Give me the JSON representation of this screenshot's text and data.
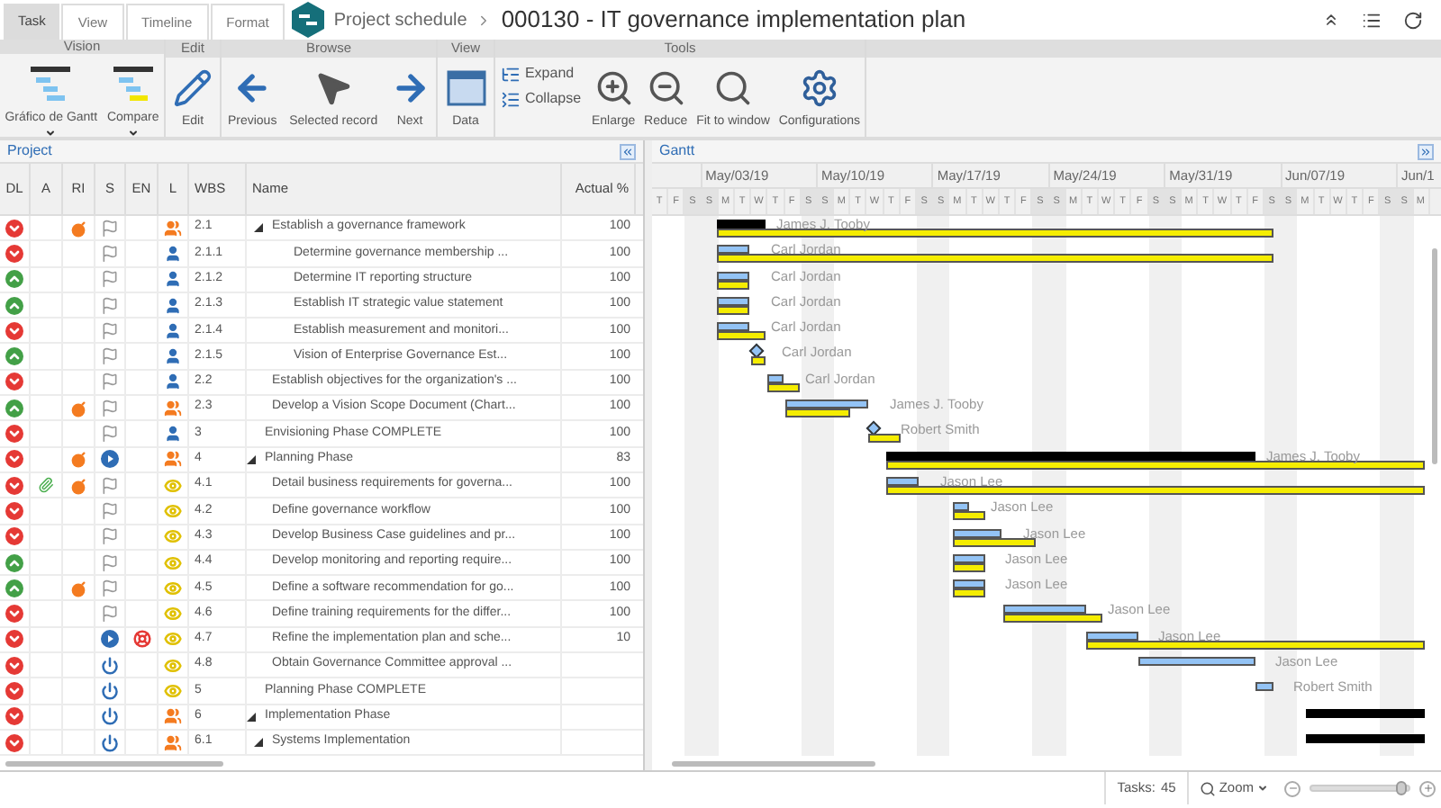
{
  "tabs": [
    {
      "label": "Task",
      "selected": true
    },
    {
      "label": "View",
      "selected": false
    },
    {
      "label": "Timeline",
      "selected": false
    },
    {
      "label": "Format",
      "selected": false
    }
  ],
  "breadcrumb": {
    "parent": "Project schedule",
    "title": "000130 - IT governance implementation plan"
  },
  "toolbar": {
    "groups": [
      {
        "label": "Vision",
        "buttons": [
          {
            "label": "Gráfico de Gantt",
            "kind": "gantt",
            "dropdown": true
          },
          {
            "label": "Compare",
            "kind": "compare",
            "dropdown": true
          }
        ]
      },
      {
        "label": "Edit",
        "buttons": [
          {
            "label": "Edit",
            "kind": "edit"
          }
        ]
      },
      {
        "label": "Browse",
        "buttons": [
          {
            "label": "Previous",
            "kind": "previous"
          },
          {
            "label": "Selected record",
            "kind": "pointer"
          },
          {
            "label": "Next",
            "kind": "next"
          }
        ]
      },
      {
        "label": "View",
        "buttons": [
          {
            "label": "Data",
            "kind": "data"
          }
        ]
      },
      {
        "label": "Tools",
        "buttons": [
          {
            "kind": "stack",
            "items": [
              {
                "label": "Expand",
                "kind": "expand"
              },
              {
                "label": "Collapse",
                "kind": "collapse"
              }
            ]
          },
          {
            "label": "Enlarge",
            "kind": "enlarge"
          },
          {
            "label": "Reduce",
            "kind": "reduce"
          },
          {
            "label": "Fit to window",
            "kind": "fit"
          },
          {
            "label": "Configurations",
            "kind": "config"
          }
        ]
      }
    ]
  },
  "project": {
    "title": "Project",
    "columns": [
      "DL",
      "A",
      "RI",
      "S",
      "EN",
      "L",
      "WBS",
      "Name",
      "Actual %"
    ],
    "tasks": [
      {
        "children": [
          {
            "late": true,
            "attachment": false,
            "risk": true,
            "status": {
              "kind": "done"
            },
            "issue": false,
            "role": {
              "kind": "team"
            },
            "wbs": "2.1",
            "name": "Establish a governance framework",
            "actual": "100",
            "resource": "James J. Tooby",
            "expanded": true,
            "children": [
              {
                "late": true,
                "attachment": false,
                "risk": false,
                "status": {
                  "kind": "done"
                },
                "issue": false,
                "role": {
                  "kind": "person"
                },
                "wbs": "2.1.1",
                "name": "Determine governance membership ...",
                "actual": "100",
                "resource": "Carl Jordan"
              },
              {
                "late": false,
                "attachment": false,
                "risk": false,
                "status": {
                  "kind": "done"
                },
                "issue": false,
                "role": {
                  "kind": "person"
                },
                "wbs": "2.1.2",
                "name": "Determine IT reporting structure",
                "actual": "100",
                "resource": "Carl Jordan"
              },
              {
                "late": false,
                "attachment": false,
                "risk": false,
                "status": {
                  "kind": "done"
                },
                "issue": false,
                "role": {
                  "kind": "person"
                },
                "wbs": "2.1.3",
                "name": "Establish IT strategic value statement",
                "actual": "100",
                "resource": "Carl Jordan"
              },
              {
                "late": true,
                "attachment": false,
                "risk": false,
                "status": {
                  "kind": "done"
                },
                "issue": false,
                "role": {
                  "kind": "person"
                },
                "wbs": "2.1.4",
                "name": "Establish measurement and monitori...",
                "actual": "100",
                "resource": "Carl Jordan"
              },
              {
                "late": false,
                "attachment": false,
                "risk": false,
                "status": {
                  "kind": "done"
                },
                "issue": false,
                "role": {
                  "kind": "person"
                },
                "wbs": "2.1.5",
                "name": "Vision of Enterprise Governance Est...",
                "actual": "100",
                "resource": "Carl Jordan"
              }
            ]
          },
          {
            "late": true,
            "attachment": false,
            "risk": false,
            "status": {
              "kind": "done"
            },
            "issue": false,
            "role": {
              "kind": "person"
            },
            "wbs": "2.2",
            "name": "Establish objectives for the organization's ...",
            "actual": "100",
            "resource": "Carl Jordan"
          },
          {
            "late": false,
            "attachment": false,
            "risk": true,
            "status": {
              "kind": "done"
            },
            "issue": false,
            "role": {
              "kind": "team"
            },
            "wbs": "2.3",
            "name": "Develop a Vision Scope Document (Chart...",
            "actual": "100",
            "resource": "James J. Tooby"
          }
        ]
      },
      {
        "late": true,
        "attachment": false,
        "risk": false,
        "status": {
          "kind": "done"
        },
        "issue": false,
        "role": {
          "kind": "person"
        },
        "wbs": "3",
        "name": "Envisioning Phase COMPLETE",
        "actual": "100",
        "resource": "Robert Smith"
      },
      {
        "late": true,
        "attachment": false,
        "risk": true,
        "status": {
          "kind": "running"
        },
        "issue": false,
        "role": {
          "kind": "team"
        },
        "wbs": "4",
        "name": "Planning Phase",
        "actual": "83",
        "resource": "James J. Tooby",
        "expanded": true,
        "children": [
          {
            "late": true,
            "attachment": true,
            "risk": true,
            "status": {
              "kind": "done"
            },
            "issue": false,
            "role": {
              "kind": "watcher"
            },
            "wbs": "4.1",
            "name": "Detail business requirements for governa...",
            "actual": "100",
            "resource": "Jason Lee"
          },
          {
            "late": true,
            "attachment": false,
            "risk": false,
            "status": {
              "kind": "done"
            },
            "issue": false,
            "role": {
              "kind": "watcher"
            },
            "wbs": "4.2",
            "name": "Define governance workflow",
            "actual": "100",
            "resource": "Jason Lee"
          },
          {
            "late": true,
            "attachment": false,
            "risk": false,
            "status": {
              "kind": "done"
            },
            "issue": false,
            "role": {
              "kind": "watcher"
            },
            "wbs": "4.3",
            "name": "Develop Business Case guidelines and pr...",
            "actual": "100",
            "resource": "Jason Lee"
          },
          {
            "late": false,
            "attachment": false,
            "risk": false,
            "status": {
              "kind": "done"
            },
            "issue": false,
            "role": {
              "kind": "watcher"
            },
            "wbs": "4.4",
            "name": "Develop monitoring and reporting require...",
            "actual": "100",
            "resource": "Jason Lee"
          },
          {
            "late": false,
            "attachment": false,
            "risk": true,
            "status": {
              "kind": "done"
            },
            "issue": false,
            "role": {
              "kind": "watcher"
            },
            "wbs": "4.5",
            "name": "Define a software recommendation for go...",
            "actual": "100",
            "resource": "Jason Lee"
          },
          {
            "late": true,
            "attachment": false,
            "risk": false,
            "status": {
              "kind": "done"
            },
            "issue": false,
            "role": {
              "kind": "watcher"
            },
            "wbs": "4.6",
            "name": "Define training requirements for the differ...",
            "actual": "100",
            "resource": "Jason Lee"
          },
          {
            "late": true,
            "attachment": false,
            "risk": false,
            "status": {
              "kind": "running"
            },
            "issue": true,
            "role": {
              "kind": "watcher"
            },
            "wbs": "4.7",
            "name": "Refine the implementation plan and sche...",
            "actual": "10",
            "resource": "Jason Lee"
          },
          {
            "late": true,
            "attachment": false,
            "risk": false,
            "status": {
              "kind": "pending"
            },
            "issue": false,
            "role": {
              "kind": "watcher"
            },
            "wbs": "4.8",
            "name": "Obtain Governance Committee approval ...",
            "resource": "Jason Lee"
          }
        ]
      },
      {
        "late": true,
        "attachment": false,
        "risk": false,
        "status": {
          "kind": "pending"
        },
        "issue": false,
        "role": {
          "kind": "watcher"
        },
        "wbs": "5",
        "name": "Planning Phase COMPLETE",
        "resource": "Robert Smith"
      },
      {
        "late": true,
        "attachment": false,
        "risk": false,
        "status": {
          "kind": "pending"
        },
        "issue": false,
        "role": {
          "kind": "team"
        },
        "wbs": "6",
        "name": "Implementation Phase",
        "expanded": true,
        "children": [
          {
            "late": true,
            "attachment": false,
            "risk": false,
            "status": {
              "kind": "pending"
            },
            "issue": false,
            "role": {
              "kind": "team"
            },
            "wbs": "6.1",
            "name": "Systems Implementation",
            "expanded": true
          }
        ]
      }
    ]
  },
  "gantt": {
    "title": "Gantt",
    "weeks": [
      "May/03/19",
      "May/10/19",
      "May/17/19",
      "May/24/19",
      "May/31/19",
      "Jun/07/19",
      "Jun/1"
    ],
    "days": [
      {
        "label": "T",
        "weekend": false
      },
      {
        "label": "F",
        "weekend": false
      },
      {
        "label": "S",
        "weekend": true
      },
      {
        "label": "S",
        "weekend": true
      },
      {
        "label": "M",
        "weekend": false
      },
      {
        "label": "T",
        "weekend": false
      },
      {
        "label": "W",
        "weekend": false
      },
      {
        "label": "T",
        "weekend": false
      },
      {
        "label": "F",
        "weekend": false
      },
      {
        "label": "S",
        "weekend": true
      },
      {
        "label": "S",
        "weekend": true
      },
      {
        "label": "M",
        "weekend": false
      },
      {
        "label": "T",
        "weekend": false
      },
      {
        "label": "W",
        "weekend": false
      },
      {
        "label": "T",
        "weekend": false
      },
      {
        "label": "F",
        "weekend": false
      },
      {
        "label": "S",
        "weekend": true
      },
      {
        "label": "S",
        "weekend": true
      },
      {
        "label": "M",
        "weekend": false
      },
      {
        "label": "T",
        "weekend": false
      },
      {
        "label": "W",
        "weekend": false
      },
      {
        "label": "T",
        "weekend": false
      },
      {
        "label": "F",
        "weekend": false
      },
      {
        "label": "S",
        "weekend": true
      },
      {
        "label": "S",
        "weekend": true
      },
      {
        "label": "M",
        "weekend": false
      },
      {
        "label": "T",
        "weekend": false
      },
      {
        "label": "W",
        "weekend": false
      },
      {
        "label": "T",
        "weekend": false
      },
      {
        "label": "F",
        "weekend": false
      },
      {
        "label": "S",
        "weekend": true
      },
      {
        "label": "S",
        "weekend": true
      },
      {
        "label": "M",
        "weekend": false
      },
      {
        "label": "T",
        "weekend": false
      },
      {
        "label": "W",
        "weekend": false
      },
      {
        "label": "T",
        "weekend": false
      },
      {
        "label": "F",
        "weekend": false
      },
      {
        "label": "S",
        "weekend": true
      },
      {
        "label": "S",
        "weekend": true
      },
      {
        "label": "M",
        "weekend": false
      },
      {
        "label": "T",
        "weekend": false
      },
      {
        "label": "W",
        "weekend": false
      },
      {
        "label": "T",
        "weekend": false
      },
      {
        "label": "F",
        "weekend": false
      },
      {
        "label": "S",
        "weekend": true
      },
      {
        "label": "S",
        "weekend": true
      },
      {
        "label": "M",
        "weekend": false
      }
    ]
  },
  "status_bar": {
    "tasks_label": "Tasks:",
    "tasks_count": "45",
    "zoom_label": "Zoom",
    "zoom": {
      "level": 0.93
    }
  }
}
